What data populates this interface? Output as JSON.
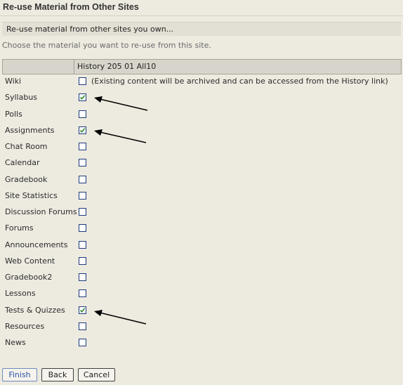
{
  "page": {
    "title": "Re-use Material from Other Sites",
    "section_bar": "Re-use material from other sites you own...",
    "instructions": "Choose the material you want to re-use from this site."
  },
  "table": {
    "site_header": "History 205 01 All10",
    "tools": [
      {
        "label": "Wiki",
        "checked": false,
        "note": "(Existing content will be archived and can be accessed from the History link)"
      },
      {
        "label": "Syllabus",
        "checked": true
      },
      {
        "label": "Polls",
        "checked": false
      },
      {
        "label": "Assignments",
        "checked": true
      },
      {
        "label": "Chat Room",
        "checked": false
      },
      {
        "label": "Calendar",
        "checked": false
      },
      {
        "label": "Gradebook",
        "checked": false
      },
      {
        "label": "Site Statistics",
        "checked": false
      },
      {
        "label": "Discussion Forums",
        "checked": false
      },
      {
        "label": "Forums",
        "checked": false
      },
      {
        "label": "Announcements",
        "checked": false
      },
      {
        "label": "Web Content",
        "checked": false
      },
      {
        "label": "Gradebook2",
        "checked": false
      },
      {
        "label": "Lessons",
        "checked": false
      },
      {
        "label": "Tests & Quizzes",
        "checked": true
      },
      {
        "label": "Resources",
        "checked": false
      },
      {
        "label": "News",
        "checked": false
      }
    ]
  },
  "buttons": {
    "finish": "Finish",
    "back": "Back",
    "cancel": "Cancel"
  },
  "colors": {
    "background": "#edeae0",
    "checkbox_border": "#1c3b7a",
    "checkmark": "#2f8a2f",
    "arrow": "#000000"
  }
}
